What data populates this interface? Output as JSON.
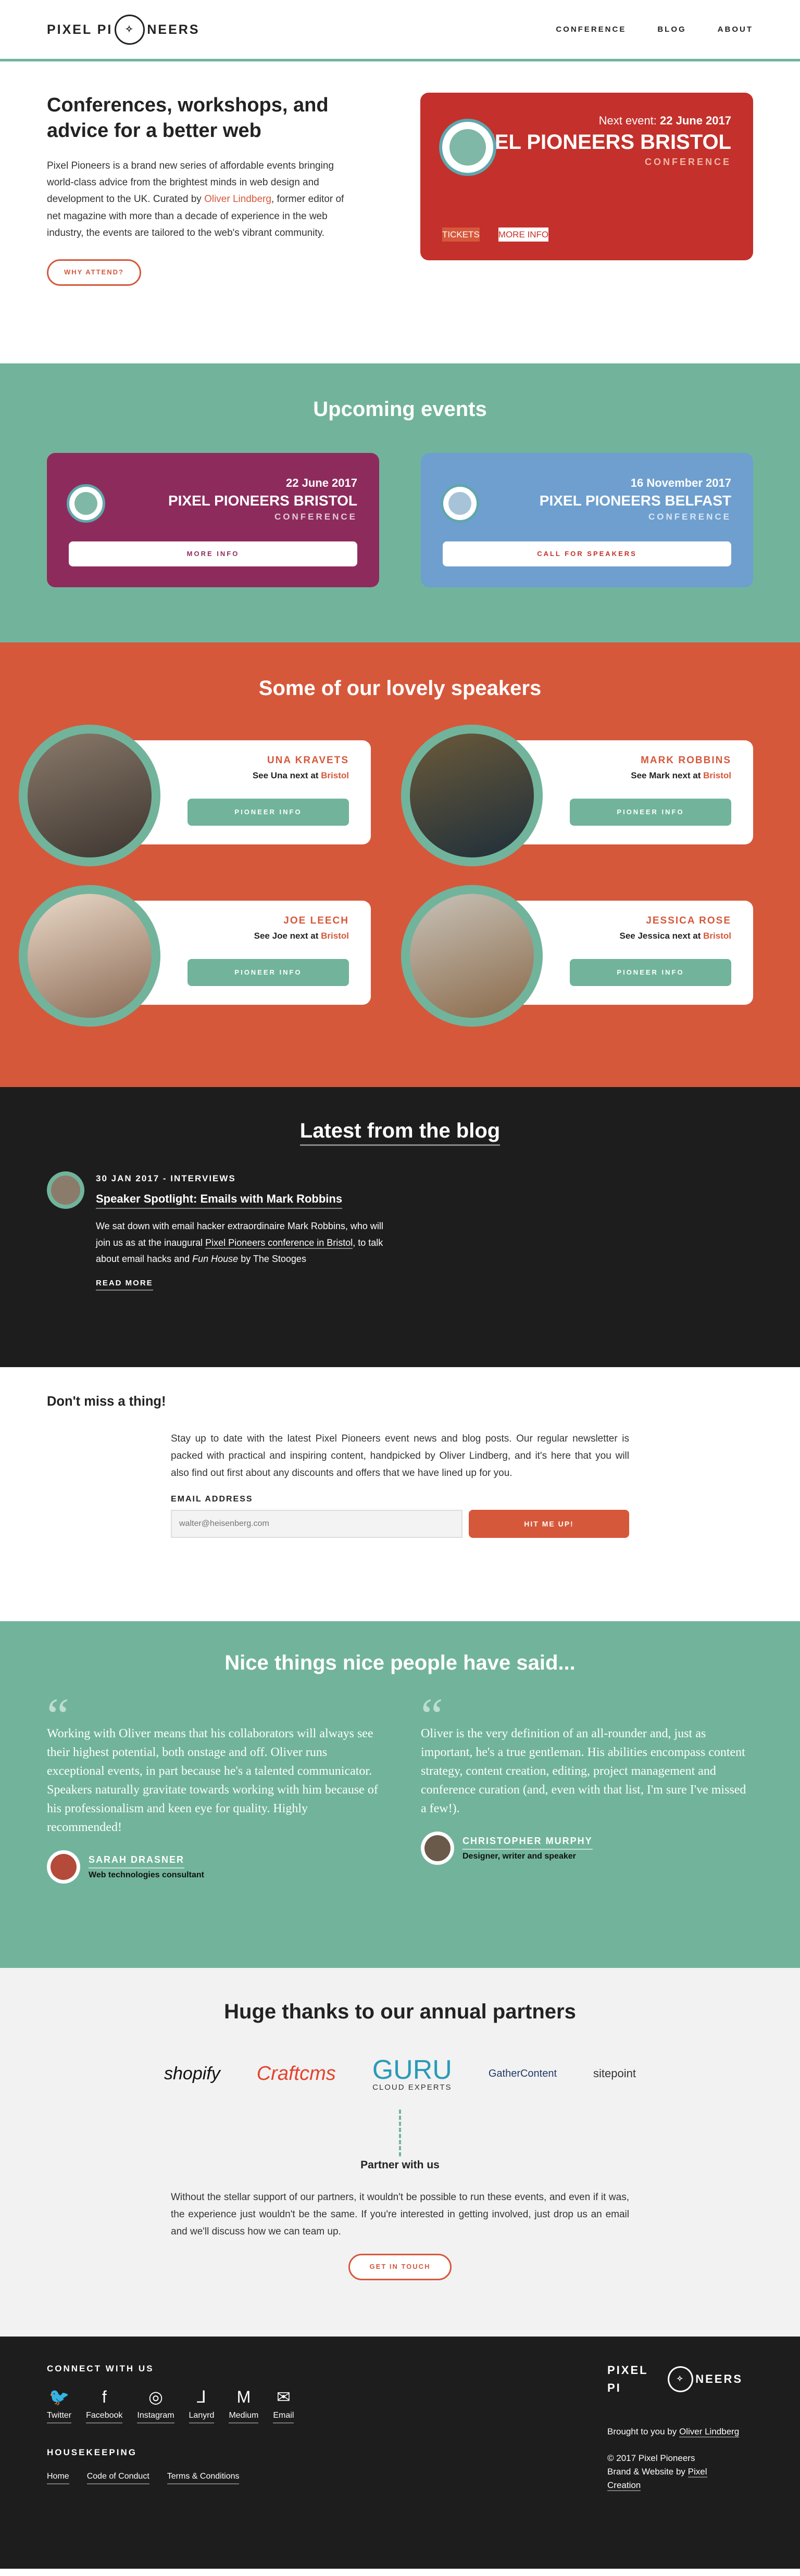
{
  "header": {
    "logo_left": "PIXEL PI",
    "logo_mark": "✧",
    "logo_right": "NEERS",
    "nav": [
      "CONFERENCE",
      "BLOG",
      "ABOUT"
    ]
  },
  "intro": {
    "title": "Conferences, workshops, and advice for a better web",
    "text_a": "Pixel Pioneers is a brand new series of affordable events bringing world-class advice from the brightest minds in web design and development to the UK. Curated by ",
    "curator": "Oliver Lindberg",
    "text_b": ", former editor of net magazine with more than a decade of experience in the web industry, the events are tailored to the web's vibrant community.",
    "button": "WHY ATTEND?"
  },
  "next_event": {
    "label": "Next event: ",
    "date": "22 June 2017",
    "title": "PIXEL PIONEERS BRISTOL",
    "sub": "CONFERENCE",
    "tickets": "TICKETS",
    "more": "MORE INFO"
  },
  "upcoming": {
    "title": "Upcoming events",
    "events": [
      {
        "date": "22 June 2017",
        "title": "PIXEL PIONEERS BRISTOL",
        "sub": "CONFERENCE",
        "button": "MORE INFO"
      },
      {
        "date": "16 November 2017",
        "title": "PIXEL PIONEERS BELFAST",
        "sub": "CONFERENCE",
        "button": "CALL FOR SPEAKERS"
      }
    ]
  },
  "speakers": {
    "title": "Some of our lovely speakers",
    "list": [
      {
        "name": "UNA KRAVETS",
        "see": "See Una next at ",
        "city": "Bristol",
        "button": "PIONEER INFO"
      },
      {
        "name": "MARK ROBBINS",
        "see": "See Mark next at ",
        "city": "Bristol",
        "button": "PIONEER INFO"
      },
      {
        "name": "JOE LEECH",
        "see": "See Joe next at ",
        "city": "Bristol",
        "button": "PIONEER INFO"
      },
      {
        "name": "JESSICA ROSE",
        "see": "See Jessica next at ",
        "city": "Bristol",
        "button": "PIONEER INFO"
      }
    ]
  },
  "blog": {
    "title": "Latest from the blog",
    "meta": "30 JAN 2017 - INTERVIEWS",
    "post_title": "Speaker Spotlight: Emails with Mark Robbins",
    "excerpt_a": "We sat down with email hacker extraordinaire Mark Robbins, who will join us as at the inaugural ",
    "excerpt_link": "Pixel Pioneers conference in Bristol",
    "excerpt_b": ", to talk about email hacks and ",
    "excerpt_italic": "Fun House",
    "excerpt_c": " by The Stooges",
    "read_more": "READ MORE"
  },
  "newsletter": {
    "title": "Don't miss a thing!",
    "text": "Stay up to date with the latest Pixel Pioneers event news and blog posts. Our regular newsletter is packed with practical and inspiring content, handpicked by Oliver Lindberg, and it's here that you will also find out first about any discounts and offers that we have lined up for you.",
    "label": "EMAIL ADDRESS",
    "placeholder": "walter@heisenberg.com",
    "button": "HIT ME UP!"
  },
  "quotes": {
    "title": "Nice things nice people have said...",
    "mark": "“",
    "list": [
      {
        "text": "Working with Oliver means that his collaborators will always see their highest potential, both onstage and off. Oliver runs exceptional events, in part because he's a talented communicator. Speakers naturally gravitate towards working with him because of his professionalism and keen eye for quality. Highly recommended!",
        "name": "SARAH DRASNER",
        "role": "Web technologies consultant"
      },
      {
        "text": "Oliver is the very definition of an all-rounder and, just as important, he's a true gentleman. His abilities encompass content strategy, content creation, editing, project management and conference curation (and, even with that list, I'm sure I've missed a few!).",
        "name": "CHRISTOPHER MURPHY",
        "role": "Designer, writer and speaker"
      }
    ]
  },
  "partners": {
    "title": "Huge thanks to our annual partners",
    "logos": {
      "shopify": "shopify",
      "craft": "Craftcms",
      "guru": "GURU",
      "guru_sub": "CLOUD EXPERTS",
      "gc": "GatherContent",
      "sitepoint": "sitepoint"
    },
    "partner_title": "Partner with us",
    "text": "Without the stellar support of our partners, it wouldn't be possible to run these events, and even if it was, the experience just wouldn't be the same. If you're interested in getting involved, just drop us an email and we'll discuss how we can team up.",
    "button": "GET IN TOUCH"
  },
  "footer": {
    "connect": "CONNECT WITH US",
    "social": [
      {
        "label": "Twitter",
        "glyph": "🐦"
      },
      {
        "label": "Facebook",
        "glyph": "f"
      },
      {
        "label": "Instagram",
        "glyph": "◎"
      },
      {
        "label": "Lanyrd",
        "glyph": "⅃"
      },
      {
        "label": "Medium",
        "glyph": "M"
      },
      {
        "label": "Email",
        "glyph": "✉"
      }
    ],
    "housekeeping": "HOUSEKEEPING",
    "links": [
      "Home",
      "Code of Conduct",
      "Terms & Conditions"
    ],
    "brought": "Brought to you by ",
    "brought_link": "Oliver Lindberg",
    "copy": "© 2017 Pixel Pioneers",
    "credit": "Brand & Website by ",
    "credit_link": "Pixel Creation"
  },
  "colors": {
    "green": "#71b49b",
    "red": "#c4302b",
    "orange": "#d6583b",
    "purple": "#8e2b5d",
    "blue": "#6e9fcf",
    "dark": "#1d1d1d"
  }
}
